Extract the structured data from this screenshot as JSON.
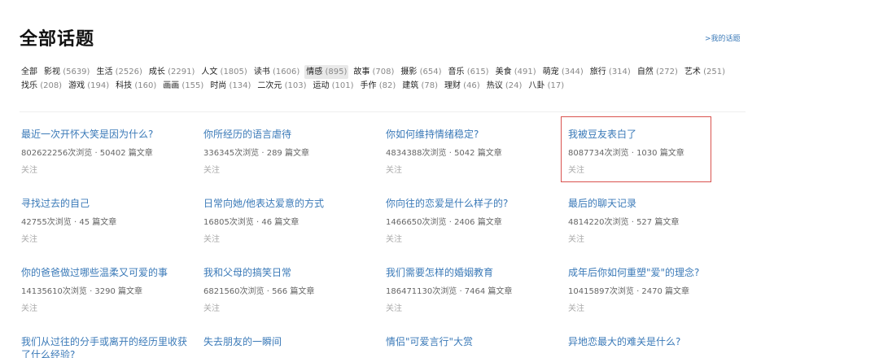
{
  "header": {
    "title": "全部话题",
    "my_topics_link": ">我的话题"
  },
  "categories": [
    {
      "name": "全部",
      "count": ""
    },
    {
      "name": "影视",
      "count": "(5639)"
    },
    {
      "name": "生活",
      "count": "(2526)"
    },
    {
      "name": "成长",
      "count": "(2291)"
    },
    {
      "name": "人文",
      "count": "(1805)"
    },
    {
      "name": "读书",
      "count": "(1606)"
    },
    {
      "name": "情感",
      "count": "(895)",
      "selected": true
    },
    {
      "name": "故事",
      "count": "(708)"
    },
    {
      "name": "摄影",
      "count": "(654)"
    },
    {
      "name": "音乐",
      "count": "(615)"
    },
    {
      "name": "美食",
      "count": "(491)"
    },
    {
      "name": "萌宠",
      "count": "(344)"
    },
    {
      "name": "旅行",
      "count": "(314)"
    },
    {
      "name": "自然",
      "count": "(272)"
    },
    {
      "name": "艺术",
      "count": "(251)"
    },
    {
      "name": "找乐",
      "count": "(208)"
    },
    {
      "name": "游戏",
      "count": "(194)"
    },
    {
      "name": "科技",
      "count": "(160)"
    },
    {
      "name": "画画",
      "count": "(155)"
    },
    {
      "name": "时尚",
      "count": "(134)"
    },
    {
      "name": "二次元",
      "count": "(103)"
    },
    {
      "name": "运动",
      "count": "(101)"
    },
    {
      "name": "手作",
      "count": "(82)"
    },
    {
      "name": "建筑",
      "count": "(78)"
    },
    {
      "name": "理财",
      "count": "(46)"
    },
    {
      "name": "热议",
      "count": "(24)"
    },
    {
      "name": "八卦",
      "count": "(17)"
    }
  ],
  "topics": [
    {
      "title": "最近一次开怀大笑是因为什么?",
      "stats": "802622256次浏览 · 50402 篇文章",
      "follow": "关注"
    },
    {
      "title": "你所经历的语言虐待",
      "stats": "336345次浏览 · 289 篇文章",
      "follow": "关注"
    },
    {
      "title": "你如何维持情绪稳定?",
      "stats": "4834388次浏览 · 5042 篇文章",
      "follow": "关注"
    },
    {
      "title": "我被豆友表白了",
      "stats": "8087734次浏览 · 1030 篇文章",
      "follow": "关注"
    },
    {
      "title": "寻找过去的自己",
      "stats": "42755次浏览 · 45 篇文章",
      "follow": "关注"
    },
    {
      "title": "日常向她/他表达爱意的方式",
      "stats": "16805次浏览 · 46 篇文章",
      "follow": "关注"
    },
    {
      "title": "你向往的恋爱是什么样子的?",
      "stats": "1466650次浏览 · 2406 篇文章",
      "follow": "关注"
    },
    {
      "title": "最后的聊天记录",
      "stats": "4814220次浏览 · 527 篇文章",
      "follow": "关注"
    },
    {
      "title": "你的爸爸做过哪些温柔又可爱的事",
      "stats": "14135610次浏览 · 3290 篇文章",
      "follow": "关注"
    },
    {
      "title": "我和父母的搞笑日常",
      "stats": "6821560次浏览 · 566 篇文章",
      "follow": "关注"
    },
    {
      "title": "我们需要怎样的婚姻教育",
      "stats": "186471130次浏览 · 7464 篇文章",
      "follow": "关注"
    },
    {
      "title": "成年后你如何重塑\"爱\"的理念?",
      "stats": "10415897次浏览 · 2470 篇文章",
      "follow": "关注"
    },
    {
      "title": "我们从过往的分手或离开的经历里收获了什么经验?",
      "stats": "",
      "follow": ""
    },
    {
      "title": "失去朋友的一瞬间",
      "stats": "",
      "follow": ""
    },
    {
      "title": "情侣\"可爱言行\"大赏",
      "stats": "",
      "follow": ""
    },
    {
      "title": "异地恋最大的难关是什么?",
      "stats": "",
      "follow": ""
    }
  ]
}
